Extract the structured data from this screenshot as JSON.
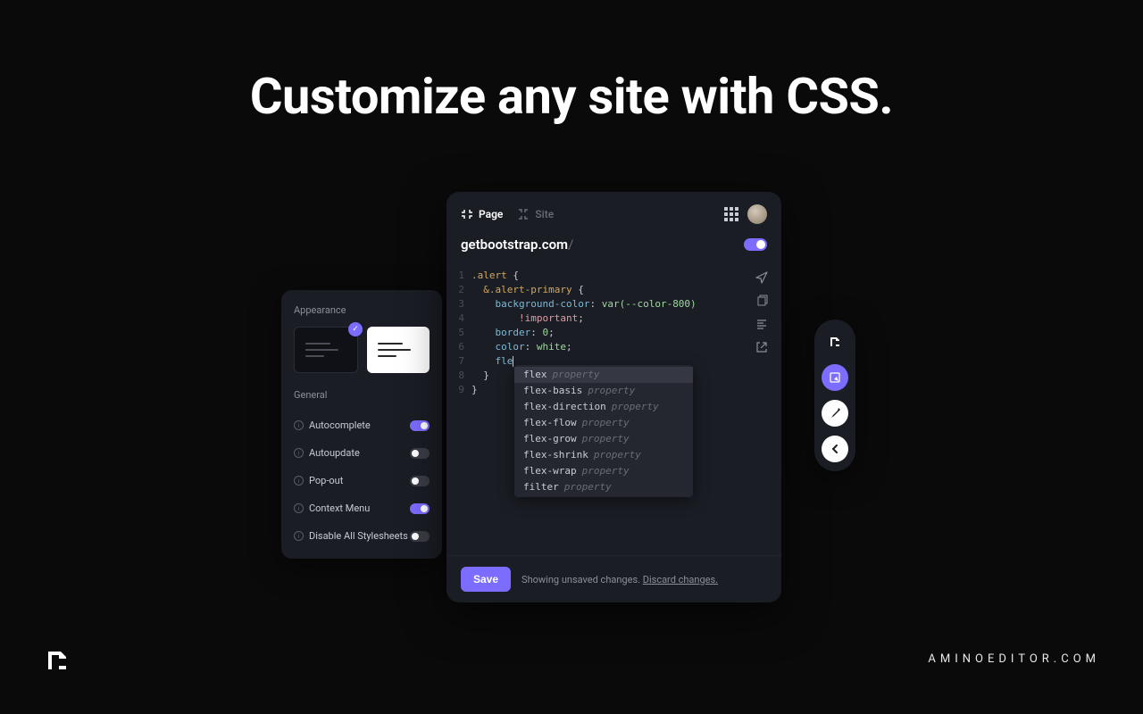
{
  "headline": "Customize any site with CSS.",
  "settings": {
    "appearance_label": "Appearance",
    "general_label": "General",
    "rows": [
      {
        "label": "Autocomplete",
        "on": true
      },
      {
        "label": "Autoupdate",
        "on": false
      },
      {
        "label": "Pop-out",
        "on": false
      },
      {
        "label": "Context Menu",
        "on": true
      },
      {
        "label": "Disable All Stylesheets",
        "on": false
      }
    ]
  },
  "editor": {
    "tabs": {
      "page": "Page",
      "site": "Site"
    },
    "domain": "getbootstrap.com",
    "path": "/",
    "code_lines": [
      {
        "n": 1,
        "html": "<span class='tok-sel'>.alert</span> <span class='tok-punc'>{</span>"
      },
      {
        "n": 2,
        "html": "  <span class='tok-sel'>&amp;.alert-primary</span> <span class='tok-punc'>{</span>"
      },
      {
        "n": 3,
        "html": "    <span class='tok-prop'>background-color</span><span class='tok-punc'>:</span> <span class='tok-val'>var(--color-800)</span>"
      },
      {
        "n": 4,
        "html": "        <span class='tok-imp'>!important</span><span class='tok-punc'>;</span>"
      },
      {
        "n": 5,
        "html": "    <span class='tok-prop'>border</span><span class='tok-punc'>:</span> <span class='tok-val'>0</span><span class='tok-punc'>;</span>"
      },
      {
        "n": 6,
        "html": "    <span class='tok-prop'>color</span><span class='tok-punc'>:</span> <span class='tok-val'>white</span><span class='tok-punc'>;</span>"
      },
      {
        "n": 7,
        "html": "    <span class='tok-prop'>fle</span><span class='cursor'></span>"
      },
      {
        "n": 8,
        "html": "  <span class='tok-punc'>}</span>"
      },
      {
        "n": 9,
        "html": "<span class='tok-punc'>}</span>"
      }
    ],
    "autocomplete": [
      {
        "name": "flex",
        "hint": "property",
        "selected": true
      },
      {
        "name": "flex-basis",
        "hint": "property"
      },
      {
        "name": "flex-direction",
        "hint": "property"
      },
      {
        "name": "flex-flow",
        "hint": "property"
      },
      {
        "name": "flex-grow",
        "hint": "property"
      },
      {
        "name": "flex-shrink",
        "hint": "property"
      },
      {
        "name": "flex-wrap",
        "hint": "property"
      },
      {
        "name": "filter",
        "hint": "property"
      }
    ],
    "save_label": "Save",
    "status_prefix": "Showing unsaved changes. ",
    "discard_label": "Discard changes."
  },
  "site_url": "AMINOEDITOR.COM"
}
